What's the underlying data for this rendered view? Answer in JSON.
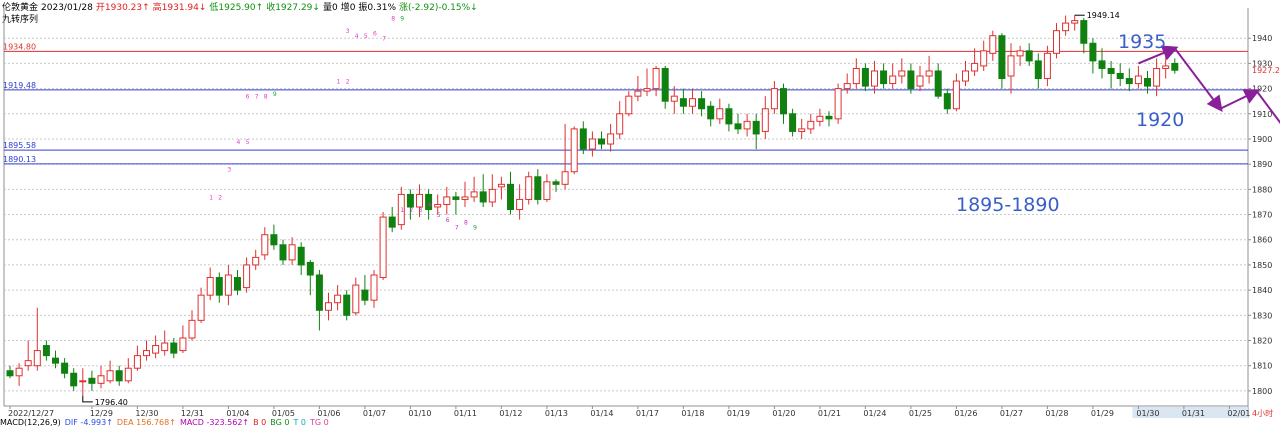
{
  "header": {
    "symbol": "伦敦黄金",
    "date": "2023/01/28",
    "open": "开1930.23↑",
    "high": "高1931.94↓",
    "low": "低1925.90↑",
    "close": "收1927.29↓",
    "volume": "量0",
    "position": "增0",
    "amplitude": "振0.31%",
    "change": "涨(-2.92)-0.15%↓",
    "indicator": "九转序列"
  },
  "macd": {
    "title": "MACD(12,26,9)",
    "dif": "DIF -4.993↑",
    "dea": "DEA 156.768↑",
    "macd": "MACD -323.562↑",
    "b": "B 0",
    "bg": "BG 0",
    "t": "T 0",
    "tg": "TG 0"
  },
  "colors": {
    "up": "#e03030",
    "down": "#108010",
    "resistance": "#e03030",
    "support": "#3040d0",
    "arrow": "#8a1f9a",
    "annotation": "#3a5fc8",
    "seq_up": "#e03ad0",
    "seq_down": "#c030c0"
  },
  "chart_data": {
    "type": "candlestick",
    "symbol": "伦敦黄金",
    "timeframe": "4小时",
    "ylim": [
      1794,
      1952
    ],
    "y_ticks": [
      1800,
      1810,
      1820,
      1830,
      1840,
      1850,
      1860,
      1870,
      1880,
      1890,
      1900,
      1910,
      1920,
      1930,
      1940
    ],
    "x_labels": [
      {
        "label": "2022/12/27",
        "index": 0
      },
      {
        "label": "12/29",
        "index": 9
      },
      {
        "label": "12/30",
        "index": 14
      },
      {
        "label": "12/31",
        "index": 19
      },
      {
        "label": "01/04",
        "index": 24
      },
      {
        "label": "01/05",
        "index": 29
      },
      {
        "label": "01/06",
        "index": 34
      },
      {
        "label": "01/07",
        "index": 39
      },
      {
        "label": "01/10",
        "index": 44
      },
      {
        "label": "01/11",
        "index": 49
      },
      {
        "label": "01/12",
        "index": 54
      },
      {
        "label": "01/13",
        "index": 59
      },
      {
        "label": "01/14",
        "index": 64
      },
      {
        "label": "01/17",
        "index": 69
      },
      {
        "label": "01/18",
        "index": 74
      },
      {
        "label": "01/19",
        "index": 79
      },
      {
        "label": "01/20",
        "index": 84
      },
      {
        "label": "01/21",
        "index": 89
      },
      {
        "label": "01/24",
        "index": 94
      },
      {
        "label": "01/25",
        "index": 99
      },
      {
        "label": "01/26",
        "index": 104
      },
      {
        "label": "01/27",
        "index": 109
      },
      {
        "label": "01/28",
        "index": 114
      },
      {
        "label": "01/29",
        "index": 119
      },
      {
        "label": "01/30",
        "index": 124
      },
      {
        "label": "01/31",
        "index": 129
      },
      {
        "label": "02/01",
        "index": 134
      }
    ],
    "timeframe_label": "4小时",
    "candles": [
      [
        1808,
        1806,
        1810,
        1805
      ],
      [
        1806,
        1809,
        1811,
        1802
      ],
      [
        1810,
        1812,
        1820,
        1808
      ],
      [
        1810,
        1816,
        1833,
        1808
      ],
      [
        1818,
        1814,
        1820,
        1812
      ],
      [
        1813,
        1811,
        1816,
        1809
      ],
      [
        1811,
        1807,
        1813,
        1805
      ],
      [
        1807,
        1802,
        1809,
        1800
      ],
      [
        1804,
        1804,
        1809,
        1798
      ],
      [
        1805,
        1803,
        1808,
        1800
      ],
      [
        1803,
        1806,
        1810,
        1801
      ],
      [
        1804,
        1808,
        1812,
        1803
      ],
      [
        1808,
        1804,
        1810,
        1802
      ],
      [
        1804,
        1809,
        1813,
        1803
      ],
      [
        1809,
        1814,
        1818,
        1808
      ],
      [
        1814,
        1816,
        1820,
        1812
      ],
      [
        1815,
        1818,
        1822,
        1813
      ],
      [
        1816,
        1819,
        1824,
        1814
      ],
      [
        1819,
        1815,
        1821,
        1813
      ],
      [
        1816,
        1821,
        1826,
        1815
      ],
      [
        1821,
        1828,
        1832,
        1820
      ],
      [
        1828,
        1838,
        1841,
        1827
      ],
      [
        1838,
        1845,
        1849,
        1836
      ],
      [
        1845,
        1838,
        1847,
        1835
      ],
      [
        1838,
        1846,
        1850,
        1834
      ],
      [
        1845,
        1840,
        1848,
        1838
      ],
      [
        1841,
        1850,
        1853,
        1839
      ],
      [
        1850,
        1853,
        1856,
        1848
      ],
      [
        1854,
        1862,
        1865,
        1852
      ],
      [
        1862,
        1858,
        1866,
        1856
      ],
      [
        1858,
        1852,
        1860,
        1850
      ],
      [
        1852,
        1858,
        1861,
        1850
      ],
      [
        1857,
        1850,
        1859,
        1846
      ],
      [
        1851,
        1846,
        1852,
        1838
      ],
      [
        1846,
        1832,
        1848,
        1824
      ],
      [
        1832,
        1835,
        1839,
        1828
      ],
      [
        1835,
        1838,
        1842,
        1832
      ],
      [
        1838,
        1830,
        1840,
        1828
      ],
      [
        1831,
        1842,
        1845,
        1830
      ],
      [
        1840,
        1836,
        1846,
        1834
      ],
      [
        1836,
        1846,
        1848,
        1833
      ],
      [
        1845,
        1869,
        1871,
        1844
      ],
      [
        1869,
        1865,
        1873,
        1863
      ],
      [
        1866,
        1878,
        1881,
        1864
      ],
      [
        1878,
        1873,
        1880,
        1868
      ],
      [
        1873,
        1878,
        1882,
        1869
      ],
      [
        1878,
        1872,
        1880,
        1868
      ],
      [
        1873,
        1874,
        1878,
        1870
      ],
      [
        1874,
        1877,
        1881,
        1870
      ],
      [
        1877,
        1876,
        1879,
        1870
      ],
      [
        1876,
        1877,
        1883,
        1873
      ],
      [
        1877,
        1879,
        1885,
        1875
      ],
      [
        1879,
        1875,
        1886,
        1873
      ],
      [
        1875,
        1880,
        1886,
        1873
      ],
      [
        1881,
        1882,
        1885,
        1876
      ],
      [
        1882,
        1872,
        1887,
        1870
      ],
      [
        1872,
        1876,
        1882,
        1868
      ],
      [
        1876,
        1885,
        1887,
        1874
      ],
      [
        1885,
        1876,
        1888,
        1874
      ],
      [
        1876,
        1883,
        1886,
        1875
      ],
      [
        1883,
        1882,
        1884,
        1879
      ],
      [
        1882,
        1887,
        1906,
        1880
      ],
      [
        1887,
        1904,
        1905,
        1886
      ],
      [
        1904,
        1896,
        1907,
        1894
      ],
      [
        1896,
        1900,
        1903,
        1893
      ],
      [
        1900,
        1898,
        1903,
        1896
      ],
      [
        1898,
        1902,
        1906,
        1895
      ],
      [
        1902,
        1910,
        1915,
        1900
      ],
      [
        1910,
        1917,
        1919,
        1909
      ],
      [
        1917,
        1919,
        1925,
        1915
      ],
      [
        1919,
        1920,
        1928,
        1917
      ],
      [
        1920,
        1928,
        1929,
        1917
      ],
      [
        1928,
        1915,
        1929,
        1912
      ],
      [
        1915,
        1917,
        1921,
        1910
      ],
      [
        1916,
        1913,
        1920,
        1910
      ],
      [
        1913,
        1916,
        1920,
        1910
      ],
      [
        1916,
        1912,
        1919,
        1909
      ],
      [
        1913,
        1908,
        1915,
        1905
      ],
      [
        1908,
        1912,
        1916,
        1906
      ],
      [
        1912,
        1906,
        1914,
        1903
      ],
      [
        1906,
        1904,
        1910,
        1902
      ],
      [
        1904,
        1907,
        1910,
        1901
      ],
      [
        1907,
        1902,
        1910,
        1896
      ],
      [
        1903,
        1912,
        1917,
        1900
      ],
      [
        1912,
        1920,
        1923,
        1910
      ],
      [
        1920,
        1910,
        1922,
        1906
      ],
      [
        1910,
        1903,
        1912,
        1901
      ],
      [
        1903,
        1904,
        1908,
        1900
      ],
      [
        1904,
        1907,
        1910,
        1902
      ],
      [
        1907,
        1909,
        1912,
        1905
      ],
      [
        1909,
        1908,
        1911,
        1905
      ],
      [
        1908,
        1920,
        1922,
        1906
      ],
      [
        1920,
        1922,
        1926,
        1918
      ],
      [
        1922,
        1928,
        1932,
        1920
      ],
      [
        1928,
        1921,
        1930,
        1919
      ],
      [
        1921,
        1927,
        1931,
        1918
      ],
      [
        1927,
        1922,
        1930,
        1920
      ],
      [
        1922,
        1925,
        1930,
        1920
      ],
      [
        1925,
        1927,
        1932,
        1922
      ],
      [
        1927,
        1920,
        1930,
        1918
      ],
      [
        1921,
        1925,
        1929,
        1919
      ],
      [
        1925,
        1927,
        1933,
        1922
      ],
      [
        1927,
        1917,
        1930,
        1916
      ],
      [
        1918,
        1912,
        1920,
        1910
      ],
      [
        1912,
        1923,
        1926,
        1911
      ],
      [
        1923,
        1927,
        1931,
        1921
      ],
      [
        1927,
        1930,
        1936,
        1925
      ],
      [
        1929,
        1935,
        1939,
        1927
      ],
      [
        1934,
        1941,
        1943,
        1931
      ],
      [
        1941,
        1924,
        1942,
        1920
      ],
      [
        1925,
        1933,
        1938,
        1918
      ],
      [
        1933,
        1935,
        1937,
        1929
      ],
      [
        1935,
        1931,
        1938,
        1929
      ],
      [
        1931,
        1924,
        1934,
        1920
      ],
      [
        1924,
        1934,
        1937,
        1921
      ],
      [
        1934,
        1943,
        1946,
        1932
      ],
      [
        1943,
        1946,
        1949,
        1941
      ],
      [
        1946,
        1947,
        1949.14,
        1943
      ],
      [
        1947,
        1938,
        1948,
        1934
      ],
      [
        1938,
        1931,
        1940,
        1926
      ],
      [
        1931,
        1928,
        1936,
        1924
      ],
      [
        1928,
        1926,
        1931,
        1920
      ],
      [
        1926,
        1924,
        1930,
        1921
      ],
      [
        1924,
        1922,
        1928,
        1919
      ],
      [
        1922,
        1925,
        1929,
        1920
      ],
      [
        1924,
        1921,
        1927,
        1918
      ],
      [
        1921,
        1928,
        1932,
        1917
      ],
      [
        1928,
        1929,
        1934,
        1924
      ],
      [
        1930,
        1927.29,
        1931.94,
        1925.9
      ]
    ],
    "extremes": {
      "high": "1949.14",
      "low": "1796.40"
    },
    "levels": [
      {
        "name": "resistance",
        "value": 1934.8,
        "label": "1934.80"
      },
      {
        "name": "support-1",
        "value": 1919.48,
        "label": "1919.48"
      },
      {
        "name": "support-2",
        "value": 1895.58,
        "label": "1895.58"
      },
      {
        "name": "support-3",
        "value": 1890.13,
        "label": "1890.13"
      }
    ],
    "last_price": "1927.29",
    "annotations": [
      {
        "name": "target-1935",
        "text": "1935"
      },
      {
        "name": "target-1920",
        "text": "1920"
      },
      {
        "name": "target-1895-1890",
        "text": "1895-1890"
      }
    ],
    "projection_path": [
      {
        "index": 124,
        "value": 1930
      },
      {
        "index": 128,
        "value": 1936
      },
      {
        "index": 133,
        "value": 1912
      },
      {
        "index": 137,
        "value": 1919
      },
      {
        "index": 143,
        "value": 1890
      }
    ],
    "sequence_labels": [
      {
        "text": "1",
        "index": 22,
        "value": 1876,
        "kind": "up"
      },
      {
        "text": "2",
        "index": 23,
        "value": 1876,
        "kind": "up"
      },
      {
        "text": "3",
        "index": 24,
        "value": 1887,
        "kind": "up"
      },
      {
        "text": "4",
        "index": 25,
        "value": 1898,
        "kind": "up"
      },
      {
        "text": "5",
        "index": 26,
        "value": 1898,
        "kind": "up"
      },
      {
        "text": "6",
        "index": 26,
        "value": 1916,
        "kind": "up"
      },
      {
        "text": "7",
        "index": 27,
        "value": 1916,
        "kind": "up"
      },
      {
        "text": "8",
        "index": 28,
        "value": 1916,
        "kind": "up"
      },
      {
        "text": "9",
        "index": 29,
        "value": 1917,
        "kind": "seq9"
      },
      {
        "text": "1",
        "index": 36,
        "value": 1922,
        "kind": "up"
      },
      {
        "text": "2",
        "index": 37,
        "value": 1922,
        "kind": "up"
      },
      {
        "text": "3",
        "index": 37,
        "value": 1942,
        "kind": "up"
      },
      {
        "text": "4",
        "index": 38,
        "value": 1940,
        "kind": "up"
      },
      {
        "text": "5",
        "index": 39,
        "value": 1940,
        "kind": "up"
      },
      {
        "text": "6",
        "index": 40,
        "value": 1941,
        "kind": "up"
      },
      {
        "text": "7",
        "index": 41,
        "value": 1939,
        "kind": "up"
      },
      {
        "text": "8",
        "index": 42,
        "value": 1947,
        "kind": "up"
      },
      {
        "text": "9",
        "index": 43,
        "value": 1947,
        "kind": "seq9"
      },
      {
        "text": "1",
        "index": 43,
        "value": 1871,
        "kind": "down"
      },
      {
        "text": "2",
        "index": 44,
        "value": 1871,
        "kind": "down"
      },
      {
        "text": "3",
        "index": 45,
        "value": 1871,
        "kind": "down"
      },
      {
        "text": "4",
        "index": 46,
        "value": 1873,
        "kind": "down"
      },
      {
        "text": "5",
        "index": 47,
        "value": 1869,
        "kind": "down"
      },
      {
        "text": "6",
        "index": 48,
        "value": 1867,
        "kind": "down"
      },
      {
        "text": "7",
        "index": 49,
        "value": 1864,
        "kind": "down"
      },
      {
        "text": "8",
        "index": 50,
        "value": 1866,
        "kind": "down"
      },
      {
        "text": "9",
        "index": 51,
        "value": 1864,
        "kind": "seq9"
      }
    ]
  }
}
